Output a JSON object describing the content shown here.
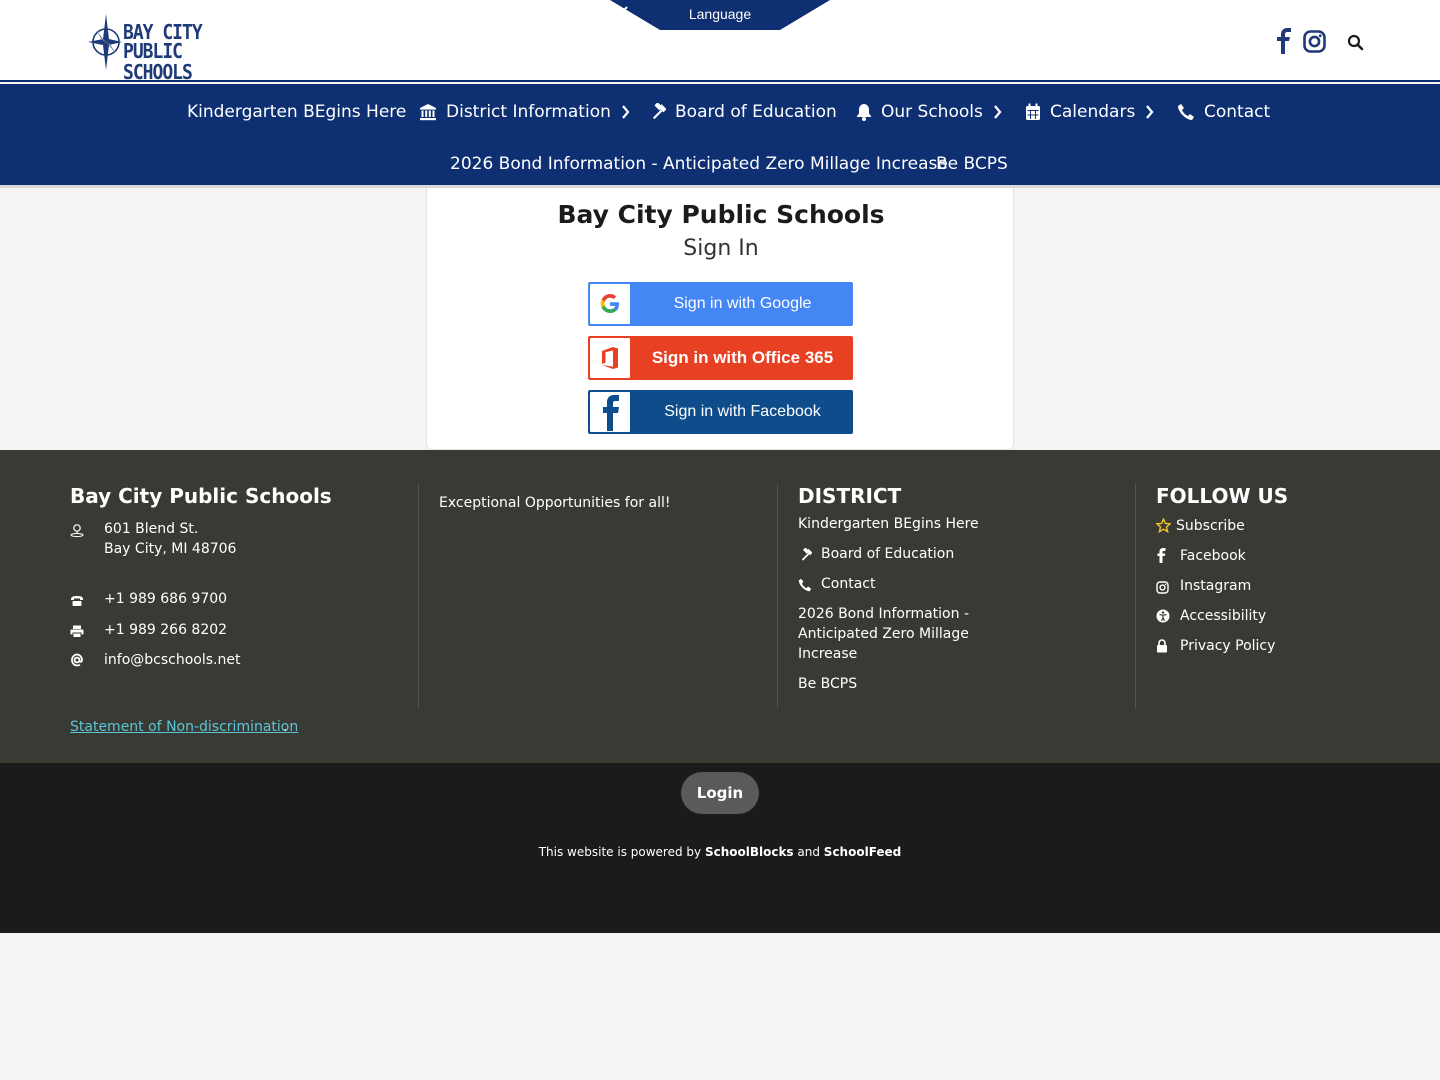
{
  "header": {
    "logo_line1": "BAY CITY",
    "logo_line2": "PUBLIC SCHOOLS",
    "language_label": "Language",
    "icons": [
      "facebook-icon",
      "instagram-icon",
      "search-icon"
    ]
  },
  "nav": {
    "items": [
      {
        "label": "Kindergarten BEgins Here",
        "icon": "",
        "has_chevron": false
      },
      {
        "label": "District Information",
        "icon": "bank-icon",
        "has_chevron": true
      },
      {
        "label": "Board of Education",
        "icon": "gavel-icon",
        "has_chevron": false
      },
      {
        "label": "Our Schools",
        "icon": "bell-icon",
        "has_chevron": true
      },
      {
        "label": "Calendars",
        "icon": "calendar-icon",
        "has_chevron": true
      },
      {
        "label": "Contact",
        "icon": "phone-icon",
        "has_chevron": false
      },
      {
        "label": "2026 Bond Information - Anticipated Zero Millage Increase",
        "icon": "",
        "has_chevron": false
      },
      {
        "label": "Be BCPS",
        "icon": "",
        "has_chevron": false
      }
    ]
  },
  "signin": {
    "title": "Bay City Public Schools",
    "subtitle": "Sign In",
    "google_label": "Sign in with Google",
    "office_label": "Sign in with Office 365",
    "facebook_label": "Sign in with Facebook"
  },
  "footer": {
    "school_name": "Bay City Public Schools",
    "address_line1": "601 Blend St.",
    "address_line2": "Bay City, MI 48706",
    "phone": "+1 989 686 9700",
    "fax": "+1 989 266 8202",
    "email": "info@bcschools.net",
    "tagline": "Exceptional Opportunities for all!",
    "district_heading": "DISTRICT",
    "district_links": [
      "Kindergarten BEgins Here",
      "Board of Education",
      "Contact",
      "2026 Bond Information -",
      "Anticipated Zero Millage",
      "Increase",
      "Be BCPS"
    ],
    "follow_heading": "FOLLOW US",
    "follow_links": [
      "Subscribe",
      "Facebook",
      "Instagram",
      "Accessibility",
      "Privacy Policy"
    ],
    "statement_link": "Statement of Non-discrimination",
    "statement_punct": "."
  },
  "bottom": {
    "login_label": "Login",
    "powered_prefix": "This website is powered by ",
    "powered_brand1": "SchoolBlocks",
    "powered_and": " and ",
    "powered_brand2": "SchoolFeed"
  },
  "colors": {
    "nav_bg": "#0e2f72",
    "google_blue": "#4486f4",
    "office_red": "#e74022",
    "facebook_blue": "#0e4c8c",
    "footer_bg": "#3a3a35",
    "bottom_bg": "#1b1b1b",
    "link_teal": "#5bc5d8",
    "star_yellow": "#f2c230"
  }
}
